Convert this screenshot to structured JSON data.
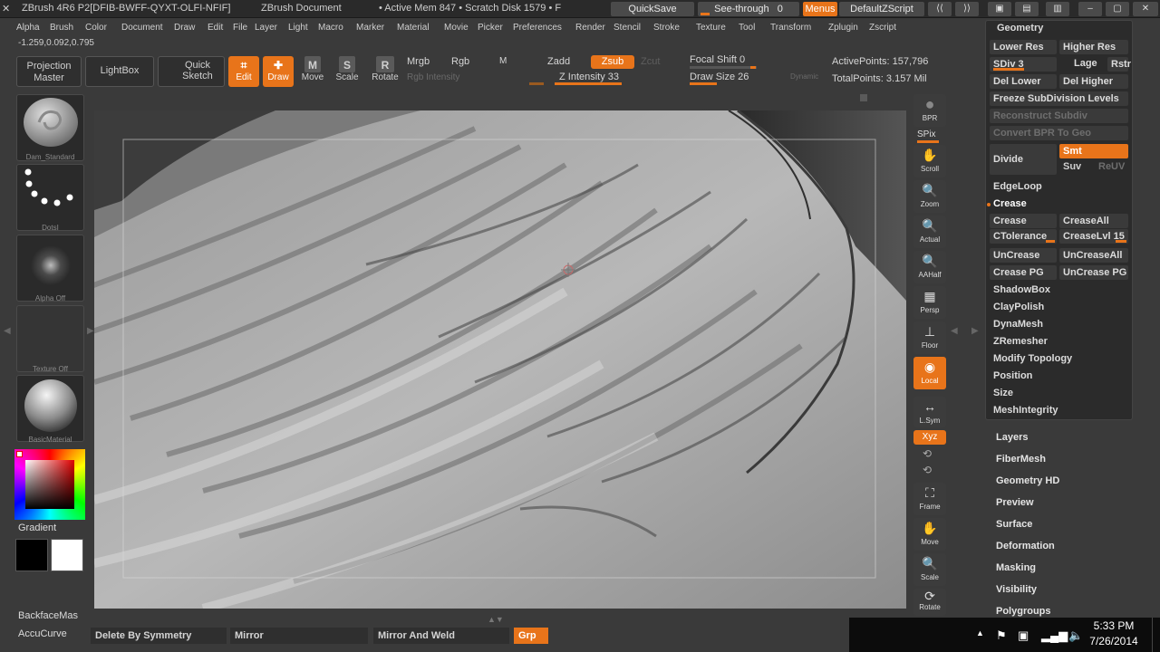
{
  "titlebar": {
    "app": "ZBrush 4R6 P2[DFIB-BWFF-QYXT-OLFI-NFIF]",
    "doc": "ZBrush Document",
    "status": "• Active Mem 847 • Scratch Disk 1579 • F",
    "quicksave": "QuickSave",
    "seethrough": "See-through",
    "seethrough_value": "0",
    "menus": "Menus",
    "script": "DefaultZScript"
  },
  "menubar": [
    "Alpha",
    "Brush",
    "Color",
    "Document",
    "Draw",
    "Edit",
    "File",
    "Layer",
    "Light",
    "Macro",
    "Marker",
    "Material",
    "Movie",
    "Picker",
    "Preferences",
    "Render",
    "Stencil",
    "Stroke",
    "Texture",
    "Tool",
    "Transform",
    "Zplugin",
    "Zscript"
  ],
  "coords": "-1.259,0.092,0.795",
  "toolbar": {
    "projection_master": [
      "Projection",
      "Master"
    ],
    "lightbox": "LightBox",
    "quick_sketch": [
      "Quick",
      "Sketch"
    ],
    "edit": "Edit",
    "draw": "Draw",
    "move": "Move",
    "scale": "Scale",
    "rotate": "Rotate",
    "mrgb": "Mrgb",
    "rgb": "Rgb",
    "m": "M",
    "rgb_intensity": "Rgb Intensity",
    "zadd": "Zadd",
    "zsub": "Zsub",
    "zcut": "Zcut",
    "z_intensity": "Z Intensity 33",
    "focal_shift": "Focal Shift 0",
    "draw_size": "Draw Size 26",
    "dynamic": "Dynamic",
    "active_points": "ActivePoints: 157,796",
    "total_points": "TotalPoints: 3.157 Mil"
  },
  "leftpanel": {
    "brush": "Dam_Standard",
    "stroke": "DotsI",
    "alpha": "Alpha Off",
    "texture": "Texture Off",
    "material": "BasicMaterial",
    "gradient": "Gradient",
    "backface": "BackfaceMas",
    "accucurve": "AccuCurve"
  },
  "shelf": [
    "BPR",
    "SPix",
    "Scroll",
    "Zoom",
    "Actual",
    "AAHalf",
    "Persp",
    "Floor",
    "Local",
    "L.Sym",
    "Xyz",
    "Frame",
    "Move",
    "Scale",
    "Rotate"
  ],
  "geometry": {
    "title": "Geometry",
    "lower_res": "Lower Res",
    "higher_res": "Higher Res",
    "sdiv": "SDiv 3",
    "lage": "Lage",
    "rstr": "Rstr",
    "del_lower": "Del Lower",
    "del_higher": "Del Higher",
    "freeze": "Freeze SubDivision Levels",
    "reconstruct": "Reconstruct Subdiv",
    "convert_bpr": "Convert BPR To Geo",
    "divide": "Divide",
    "smt": "Smt",
    "suv": "Suv",
    "reuv": "ReUV",
    "edgeloop": "EdgeLoop",
    "crease_header": "Crease",
    "crease": "Crease",
    "creaseall": "CreaseAll",
    "ctolerance": "CTolerance",
    "creaselvl": "CreaseLvl 15",
    "uncrease": "UnCrease",
    "uncreaseall": "UnCreaseAll",
    "crease_pg": "Crease PG",
    "uncrease_pg": "UnCrease PG",
    "shadowbox": "ShadowBox",
    "claypolish": "ClayPolish",
    "dynamesh": "DynaMesh",
    "zremesher": "ZRemesher",
    "modify_topology": "Modify Topology",
    "position": "Position",
    "size": "Size",
    "meshintegrity": "MeshIntegrity"
  },
  "subpalettes": [
    "Layers",
    "FiberMesh",
    "Geometry HD",
    "Preview",
    "Surface",
    "Deformation",
    "Masking",
    "Visibility",
    "Polygroups"
  ],
  "bottom": {
    "delete_sym": "Delete By Symmetry",
    "mirror": "Mirror",
    "mirror_weld": "Mirror And Weld",
    "grp": "Grp"
  },
  "taskbar": {
    "time": "5:33 PM",
    "date": "7/26/2014"
  },
  "colors": {
    "accent": "#e8741a",
    "panel": "#2b2b2b",
    "bg": "#3a3a3a"
  }
}
